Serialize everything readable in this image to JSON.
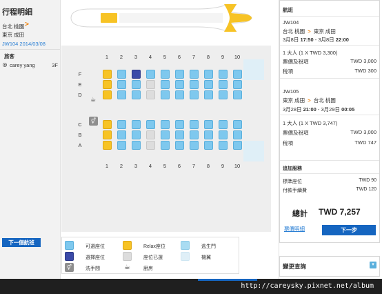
{
  "itinerary": {
    "title": "行程明細",
    "origin": "台北 桃園",
    "destination": "東京 成田",
    "flight_date": "JW104 2014/03/08",
    "passengers_header": "旅客",
    "passengers": [
      {
        "name": "carey yang",
        "seat": "3F"
      }
    ],
    "next_flight_button": "下一個航班"
  },
  "seatmap": {
    "columns": [
      "1",
      "2",
      "3",
      "4",
      "5",
      "6",
      "7",
      "8",
      "9",
      "10"
    ],
    "rows_upper": [
      "F",
      "E",
      "D"
    ],
    "rows_lower": [
      "C",
      "B",
      "A"
    ],
    "seats": {
      "F": [
        "relax",
        "avail",
        "sel",
        "avail",
        "avail",
        "avail",
        "avail",
        "avail",
        "avail",
        "avail"
      ],
      "E": [
        "relax",
        "avail",
        "avail",
        "taken",
        "avail",
        "avail",
        "avail",
        "avail",
        "avail",
        "avail"
      ],
      "D": [
        "relax",
        "avail",
        "avail",
        "taken",
        "avail",
        "avail",
        "avail",
        "avail",
        "avail",
        "avail"
      ],
      "C": [
        "relax",
        "avail",
        "avail",
        "avail",
        "avail",
        "avail",
        "avail",
        "avail",
        "avail",
        "avail"
      ],
      "B": [
        "relax",
        "avail",
        "avail",
        "taken",
        "avail",
        "avail",
        "avail",
        "avail",
        "avail",
        "avail"
      ],
      "A": [
        "relax",
        "avail",
        "avail",
        "taken",
        "avail",
        "avail",
        "avail",
        "avail",
        "avail",
        "avail"
      ]
    }
  },
  "legend": {
    "available": "可選座位",
    "relax": "Relax座位",
    "exit": "逃生門",
    "selected": "選擇座位",
    "taken": "座位已選",
    "wing": "機翼",
    "lavatory": "洗手間",
    "galley": "廚房"
  },
  "summary": {
    "header": "航班",
    "flights": [
      {
        "flight_no": "JW104",
        "from": "台北 桃園",
        "to": "東京 成田",
        "dep_date": "3月8日",
        "dep_time": "17:50",
        "arr_date": "3月8日",
        "arr_time": "22:00",
        "pax": "1 大人 (1 X TWD 3,300)",
        "fare_label": "票價及稅項",
        "fare_value": "TWD 3,000",
        "tax_label": "稅項",
        "tax_value": "TWD 300"
      },
      {
        "flight_no": "JW105",
        "from": "東京 成田",
        "to": "台北 桃園",
        "dep_date": "3月28日",
        "dep_time": "21:00",
        "arr_date": "3月29日",
        "arr_time": "00:05",
        "pax": "1 大人 (1 X TWD 3,747)",
        "fare_label": "票價及稅項",
        "fare_value": "TWD 3,000",
        "tax_label": "稅項",
        "tax_value": "TWD 747"
      }
    ],
    "addons_header": "追加服務",
    "addons": [
      {
        "label": "標準座位",
        "value": "TWD 90"
      },
      {
        "label": "付款手續費",
        "value": "TWD 120"
      }
    ],
    "total_label": "總計",
    "total_value": "TWD 7,257",
    "fare_details_link": "票價明細",
    "next_step_button": "下一步",
    "change_search": "變更查詢"
  },
  "watermark": "http://careysky.pixnet.net/album",
  "colors": {
    "available": "#7ec8ee",
    "relax": "#f7c325",
    "selected": "#3b4aa8",
    "taken": "#dddddd",
    "accent": "#f07d00",
    "button": "#1565c0"
  }
}
